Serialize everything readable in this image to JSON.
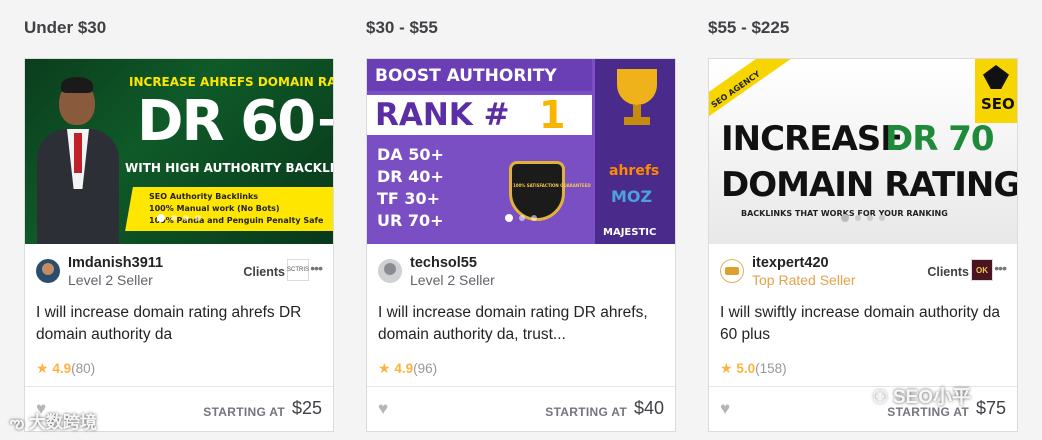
{
  "columns": [
    {
      "title": "Under $30",
      "gig": {
        "thumb_lines": [
          "INCREASE AHREFS DOMAIN RATING",
          "DR 60+",
          "WITH HIGH AUTHORITY BACKLINKS",
          "SEO Authority Backlinks",
          "100% Manual work (No Bots)",
          "100% Panda and Penguin Penalty Safe"
        ],
        "seller": "Imdanish3911",
        "level": "Level 2 Seller",
        "clients_label": "Clients",
        "client_logo_text": "SCTRIS",
        "title": "I will increase domain rating ahrefs DR domain authority da",
        "rating": "4.9",
        "reviews": "(80)",
        "starting_label": "STARTING AT",
        "price": "$25"
      }
    },
    {
      "title": "$30 - $55",
      "gig": {
        "thumb_lines": [
          "BOOST AUTHORITY",
          "RANK #",
          "1",
          "DA  50+",
          "DR  40+",
          "TF  30+",
          "UR  70+",
          "100% SATISFACTION GUARANTEED",
          "ahrefs",
          "MOZ",
          "MAJESTIC"
        ],
        "seller": "techsol55",
        "level": "Level 2 Seller",
        "title": "I will increase domain rating DR ahrefs, domain authority da, trust...",
        "rating": "4.9",
        "reviews": "(96)",
        "starting_label": "STARTING AT",
        "price": "$40"
      }
    },
    {
      "title": "$55 - $225",
      "gig": {
        "thumb_lines": [
          "SEO AGENCY",
          "INCREASE",
          "DR 70",
          "DOMAIN RATING",
          "BACKLINKS THAT WORKS FOR YOUR RANKING",
          "SEO"
        ],
        "seller": "itexpert420",
        "level": "Top Rated Seller",
        "clients_label": "Clients",
        "client_logo_text": "OK",
        "title": "I will swiftly increase domain authority da 60 plus",
        "rating": "5.0",
        "reviews": "(158)",
        "starting_label": "STARTING AT",
        "price": "$75"
      }
    }
  ],
  "watermarks": {
    "left": "大数跨境",
    "right": "SEO小平"
  },
  "icons": {
    "star": "star-icon",
    "heart": "heart-icon",
    "more": "more-options-icon"
  },
  "colors": {
    "accent_star": "#ffb33e",
    "top_rated": "#e6a14a",
    "text": "#404145"
  }
}
